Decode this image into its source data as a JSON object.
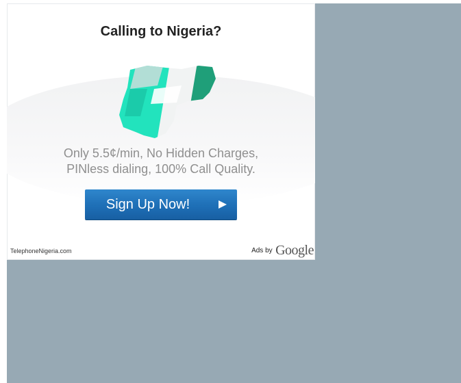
{
  "ad": {
    "headline": "Calling to Nigeria?",
    "body_line1": "Only 5.5¢/min, No Hidden Charges,",
    "body_line2": "PINless dialing, 100% Call Quality.",
    "cta_label": "Sign Up Now!",
    "display_url": "TelephoneNigeria.com",
    "ads_by_label": "Ads by",
    "ads_by_brand": "Google"
  },
  "icons": {
    "map": "nigeria-flag-map-icon",
    "arrow": "play-arrow-icon"
  },
  "colors": {
    "backdrop": "#97a9b4",
    "ad_background": "#ffffff",
    "button": "#1e6fb6",
    "flag_green": "#1f9f79",
    "flag_light_green": "#22e3bd"
  }
}
